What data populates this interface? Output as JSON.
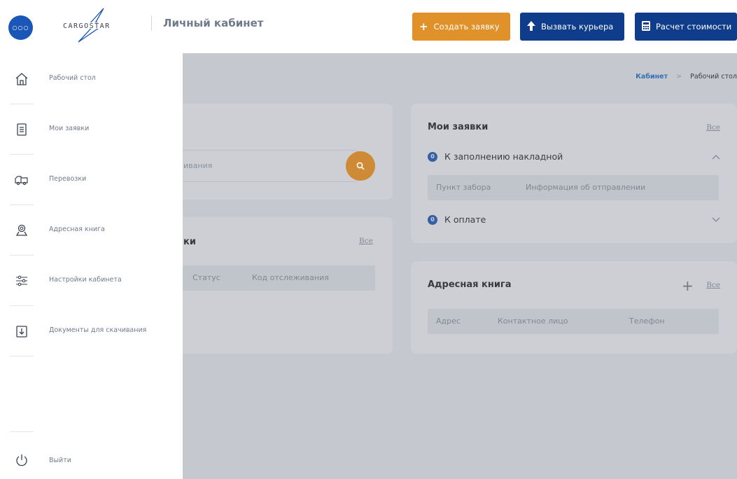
{
  "header": {
    "menu_glyph": "○○○",
    "logo_text": "CARGOSTAR",
    "title": "Личный кабинет",
    "buttons": [
      {
        "label": "Создать заявку",
        "icon": "plus-icon",
        "color": "#e0912a"
      },
      {
        "label": "Вызвать курьера",
        "icon": "arrow-up-icon",
        "color": "#0f3d8c"
      },
      {
        "label": "Расчет стоимости",
        "icon": "calculator-icon",
        "color": "#0f3d8c"
      }
    ]
  },
  "breadcrumb": {
    "link": "Кабинет",
    "separator": ">",
    "current": "Рабочий стол"
  },
  "search_card": {
    "placeholder_fragment": "ивания"
  },
  "tracking_card": {
    "title_fragment": "ки",
    "all_link": "Все",
    "columns": [
      "Статус",
      "Код отслеживания"
    ]
  },
  "orders_card": {
    "title": "Мои заявки",
    "all_link": "Все",
    "groups": [
      {
        "label": "К заполнению накладной",
        "badge": "0",
        "expanded": true,
        "columns": [
          "Пункт забора",
          "Информация об отправлении"
        ]
      },
      {
        "label": "К оплате",
        "badge": "0",
        "expanded": false
      }
    ]
  },
  "address_card": {
    "title": "Адресная книга",
    "add_glyph": "+",
    "all_link": "Все",
    "columns": [
      "Адрес",
      "Контактное лицо",
      "Телефон"
    ]
  },
  "sidebar": {
    "items": [
      {
        "label": "Рабочий стол",
        "icon": "home-icon"
      },
      {
        "label": "Мои заявки",
        "icon": "document-icon"
      },
      {
        "label": "Перевозки",
        "icon": "truck-icon"
      },
      {
        "label": "Адресная книга",
        "icon": "location-pin-icon"
      },
      {
        "label": "Настройки кабинета",
        "icon": "sliders-icon"
      },
      {
        "label": "Документы для скачивания",
        "icon": "download-icon"
      }
    ],
    "logout": {
      "label": "Выйти",
      "icon": "power-icon"
    }
  },
  "colors": {
    "brand_blue": "#0f3d8c",
    "accent_orange": "#e0912a",
    "link_blue": "#1a6ecf",
    "overlay": "rgba(108,114,128,0.34)"
  }
}
